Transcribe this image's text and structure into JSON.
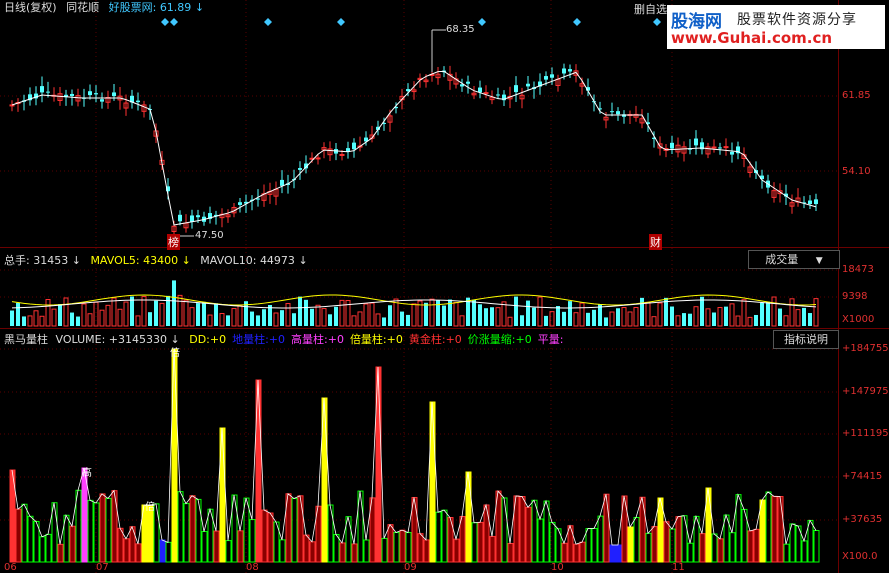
{
  "title_bar": {
    "period": "日线(复权)",
    "stock_name": "同花顺",
    "index_label": "好股票网:",
    "index_value": "61.89",
    "index_arrow": "↓",
    "right_label": "删自选"
  },
  "watermark": {
    "brand": "股海网",
    "slogan": "股票软件资源分享",
    "url": "www.Guhai.com.cn"
  },
  "price_pane": {
    "high_label": "68.35",
    "low_label": "47.50",
    "y_ticks": [
      "61.85",
      "54.10"
    ],
    "markers": [
      "榜",
      "财"
    ],
    "colors": {
      "up": "#ff3232",
      "down": "#54ffff",
      "ma": "#ffffff"
    }
  },
  "volume_pane": {
    "header": [
      {
        "label": "总手:",
        "value": "31453",
        "arrow": "↓"
      },
      {
        "label": "MAVOL5:",
        "value": "43400",
        "arrow": "↓"
      },
      {
        "label": "MAVOL10:",
        "value": "44973",
        "arrow": "↓"
      }
    ],
    "dropdown_label": "成交量",
    "dropdown_icon": "chevron-down-icon",
    "y_ticks": [
      "18473",
      "9398",
      "X1000"
    ]
  },
  "indicator_pane": {
    "title": "黑马量柱",
    "volume_label": "VOLUME:",
    "volume_value": "+3145330",
    "volume_arrow": "↓",
    "items": [
      {
        "label": "DD:",
        "value": "+0",
        "color": "#ffff00"
      },
      {
        "label": "地量柱:",
        "value": "+0",
        "color": "#2020ff"
      },
      {
        "label": "高量柱:",
        "value": "+0",
        "color": "#ff40ff"
      },
      {
        "label": "倍量柱:",
        "value": "+0",
        "color": "#ffff00"
      },
      {
        "label": "黄金柱:",
        "value": "+0",
        "color": "#ff3030"
      },
      {
        "label": "价涨量缩:",
        "value": "+0",
        "color": "#00ff00"
      },
      {
        "label": "平量:",
        "value": "",
        "color": "#ff40ff"
      }
    ],
    "button_label": "指标说明",
    "y_ticks": [
      "+184755",
      "+147975",
      "+111195",
      "+74415",
      "+37635",
      "X100.0"
    ],
    "bar_markers": [
      "倍",
      "高",
      "倍"
    ]
  },
  "x_axis": {
    "months": [
      "06",
      "07",
      "08",
      "09",
      "10",
      "11"
    ]
  }
}
